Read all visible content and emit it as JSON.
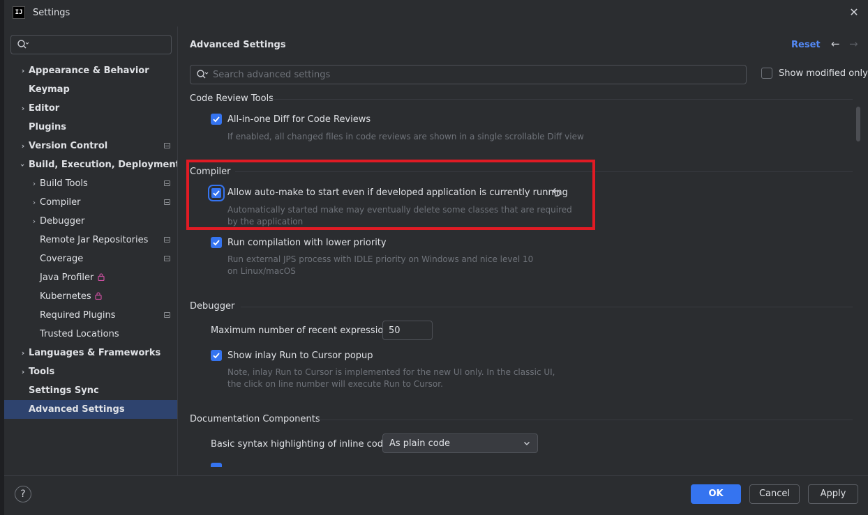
{
  "window": {
    "title": "Settings",
    "logo_text": "IJ"
  },
  "sidebar": {
    "search_placeholder": "",
    "items": [
      {
        "label": "Appearance & Behavior",
        "bold": true,
        "chevron": "right"
      },
      {
        "label": "Keymap",
        "bold": true
      },
      {
        "label": "Editor",
        "bold": true,
        "chevron": "right"
      },
      {
        "label": "Plugins",
        "bold": true
      },
      {
        "label": "Version Control",
        "bold": true,
        "chevron": "right",
        "project": true
      },
      {
        "label": "Build, Execution, Deployment",
        "bold": true,
        "chevron": "down"
      },
      {
        "label": "Build Tools",
        "chevron": "right",
        "project": true
      },
      {
        "label": "Compiler",
        "chevron": "right",
        "project": true
      },
      {
        "label": "Debugger",
        "chevron": "right"
      },
      {
        "label": "Remote Jar Repositories",
        "project": true
      },
      {
        "label": "Coverage",
        "project": true
      },
      {
        "label": "Java Profiler",
        "lock": true
      },
      {
        "label": "Kubernetes",
        "lock": true
      },
      {
        "label": "Required Plugins",
        "project": true
      },
      {
        "label": "Trusted Locations"
      },
      {
        "label": "Languages & Frameworks",
        "bold": true,
        "chevron": "right"
      },
      {
        "label": "Tools",
        "bold": true,
        "chevron": "right"
      },
      {
        "label": "Settings Sync",
        "bold": true
      },
      {
        "label": "Advanced Settings",
        "bold": true,
        "selected": true
      }
    ]
  },
  "main": {
    "title": "Advanced Settings",
    "reset_label": "Reset",
    "search_placeholder": "Search advanced settings",
    "show_modified_label": "Show modified only",
    "sections": {
      "code_review": {
        "heading": "Code Review Tools",
        "opt1_label": "All-in-one Diff for Code Reviews",
        "opt1_desc": "If enabled, all changed files in code reviews are shown in a single scrollable Diff view"
      },
      "compiler": {
        "heading": "Compiler",
        "opt1_label": "Allow auto-make to start even if developed application is currently running",
        "opt1_desc": "Automatically started make may eventually delete some classes that are required by the application",
        "opt2_label": "Run compilation with lower priority",
        "opt2_desc": "Run external JPS process with IDLE priority on Windows and nice level 10 on Linux/macOS"
      },
      "debugger": {
        "heading": "Debugger",
        "max_expr_label": "Maximum number of recent expressions:",
        "max_expr_value": "50",
        "opt1_label": "Show inlay Run to Cursor popup",
        "opt1_desc": "Note, inlay Run to Cursor is implemented for the new UI only. In the classic UI, the click on line number will execute Run to Cursor."
      },
      "documentation": {
        "heading": "Documentation Components",
        "syntax_label": "Basic syntax highlighting of inline code:",
        "syntax_value": "As plain code"
      }
    }
  },
  "footer": {
    "help_label": "?",
    "ok_label": "OK",
    "cancel_label": "Cancel",
    "apply_label": "Apply"
  },
  "colors": {
    "accent": "#3574f0",
    "link": "#548af7",
    "highlight_border": "#e01b24",
    "selection": "#2e436e"
  }
}
